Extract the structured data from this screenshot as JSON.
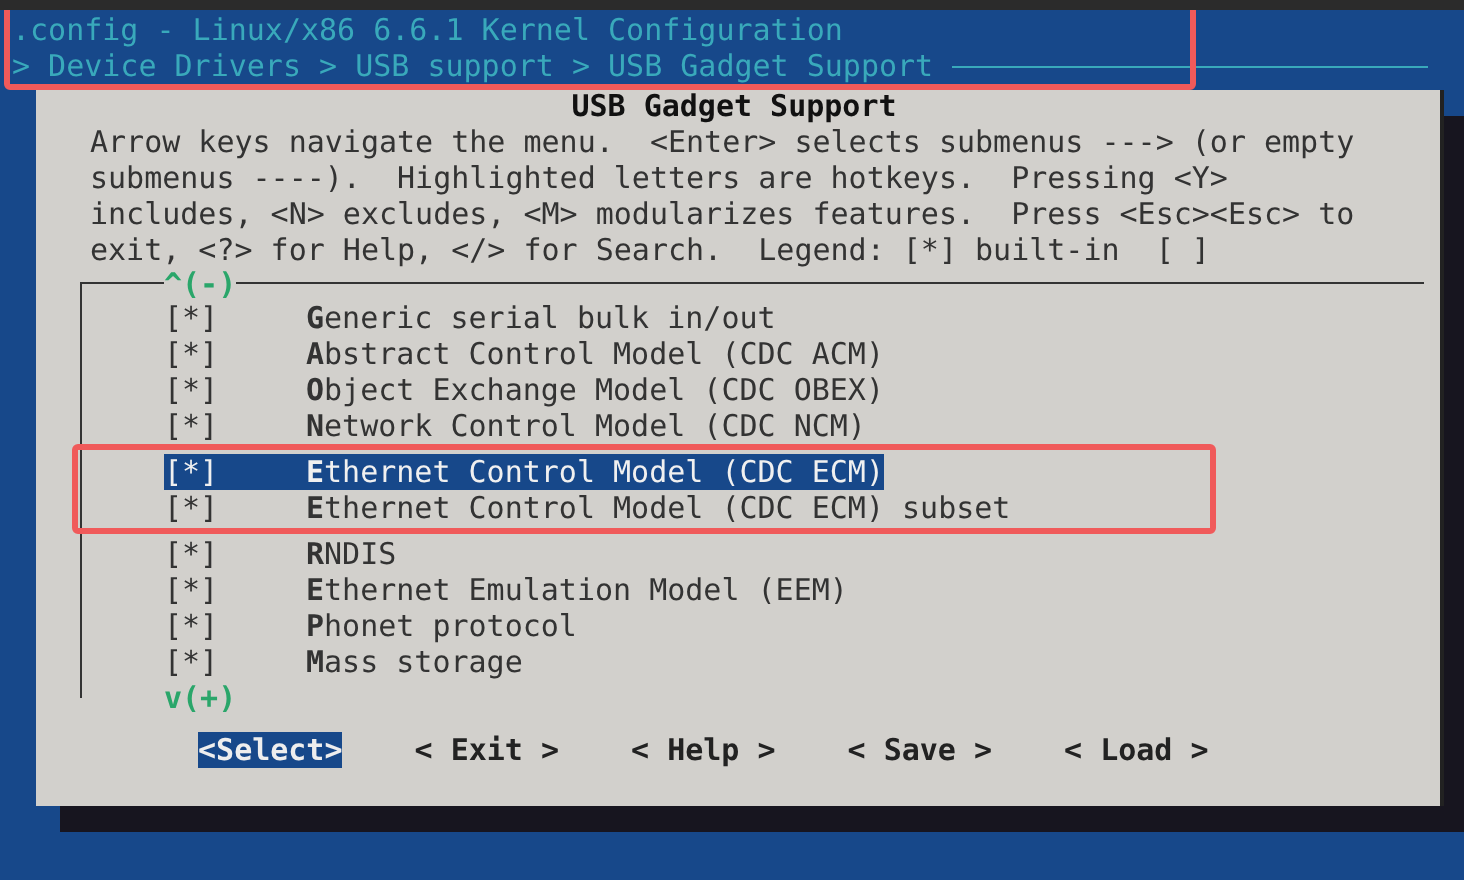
{
  "window": {
    "title": ".config - Linux/x86 6.6.1 Kernel Configuration",
    "breadcrumb": "> Device Drivers > USB support > USB Gadget Support"
  },
  "dialog": {
    "title": "USB Gadget Support",
    "help_lines": [
      "Arrow keys navigate the menu.  <Enter> selects submenus ---> (or empty",
      "submenus ----).  Highlighted letters are hotkeys.  Pressing <Y>",
      "includes, <N> excludes, <M> modularizes features.  Press <Esc><Esc> to",
      "exit, <?> for Help, </> for Search.  Legend: [*] built-in  [ ]"
    ]
  },
  "menu": {
    "top_indicator": "^(-)",
    "bottom_indicator": "v(+)",
    "items": [
      {
        "state": "[*]",
        "label": "**G**eneric serial bulk in/out",
        "selected": false
      },
      {
        "state": "[*]",
        "label": "**A**bstract Control Model (CDC ACM)",
        "selected": false
      },
      {
        "state": "[*]",
        "label": "**O**bject Exchange Model (CDC OBEX)",
        "selected": false
      },
      {
        "state": "[*]",
        "label": "**N**etwork Control Model (CDC NCM)",
        "selected": false
      },
      {
        "state": "[*]",
        "label": "**E**thernet Control Model (CDC ECM)",
        "selected": true
      },
      {
        "state": "[*]",
        "label": "**E**thernet Control Model (CDC ECM) subset",
        "selected": false
      },
      {
        "state": "[*]",
        "label": "**R**NDIS",
        "selected": false
      },
      {
        "state": "[*]",
        "label": "**E**thernet Emulation Model (EEM)",
        "selected": false
      },
      {
        "state": "[*]",
        "label": "**P**honet protocol",
        "selected": false
      },
      {
        "state": "[*]",
        "label": "**M**ass storage",
        "selected": false
      }
    ]
  },
  "buttons": [
    {
      "label": "<**S**elect>",
      "selected": true
    },
    {
      "label": "< **E**xit >",
      "selected": false
    },
    {
      "label": "< **H**elp >",
      "selected": false
    },
    {
      "label": "< **S**ave >",
      "selected": false
    },
    {
      "label": "< **L**oad >",
      "selected": false
    }
  ]
}
